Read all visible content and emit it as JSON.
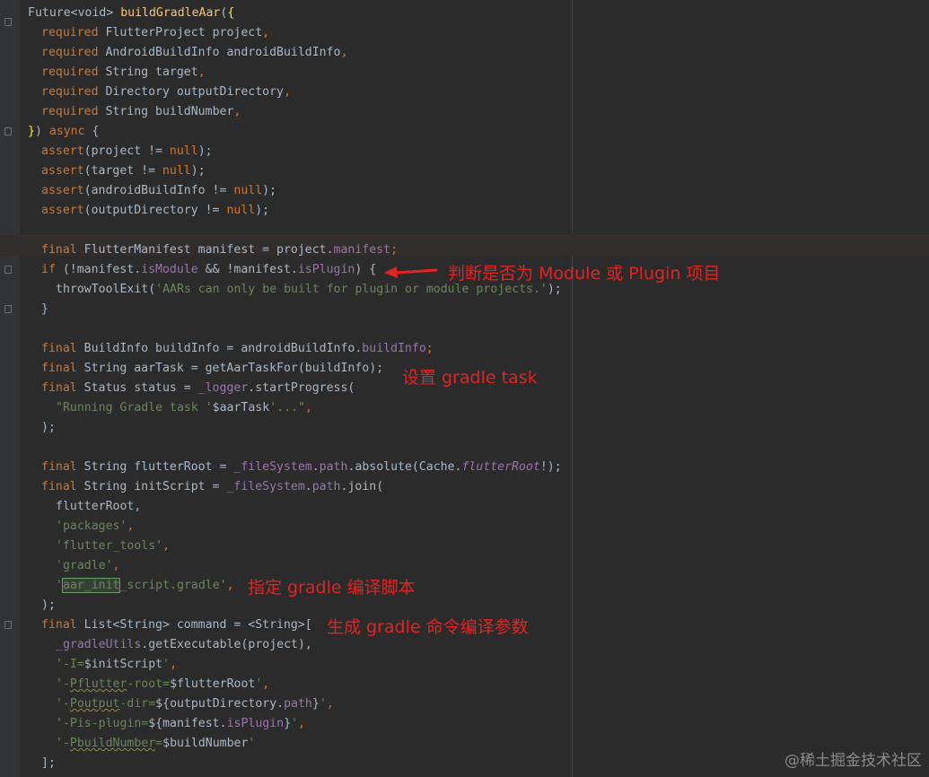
{
  "code": {
    "l1_a": "Future<void> ",
    "l1_fn": "buildGradleAar",
    "l1_p": "(",
    "l1_b": "{",
    "l2_kw": "required",
    "l2_t": " FlutterProject project",
    "l3_kw": "required",
    "l3_t": " AndroidBuildInfo androidBuildInfo",
    "l4_kw": "required",
    "l4_t": " String target",
    "l5_kw": "required",
    "l5_t": " Directory outputDirectory",
    "l6_kw": "required",
    "l6_t": " String buildNumber",
    "comma": ",",
    "l7_b": "}",
    "l7_p": ") ",
    "l7_kw": "async",
    "l7_o": " {",
    "assert": "assert",
    "null": "null",
    "l8_t": "(project != ",
    "l9_t": "(target != ",
    "l10_t": "(androidBuildInfo != ",
    "l11_t": "(outputDirectory != ",
    "close_semi": ");",
    "final": "final",
    "l13_t": " FlutterManifest manifest = project.",
    "l13_f": "manifest",
    "semi": ";",
    "l14_kw": "if",
    "l14_a": " (!manifest.",
    "l14_f1": "isModule",
    "l14_b": " && !manifest.",
    "l14_f2": "isPlugin",
    "l14_c": ") {",
    "l15_a": "throwToolExit(",
    "l15_s": "'AARs can only be built for plugin or module projects.'",
    "l16": "}",
    "l18_t": " BuildInfo buildInfo = androidBuildInfo.",
    "l18_f": "buildInfo",
    "l19_t": " String aarTask = getAarTaskFor(buildInfo);",
    "l20_t": " Status status = ",
    "l20_f": "_logger",
    "l20_u": ".startProgress(",
    "l21_s1": "\"Running Gradle task '",
    "l21_v": "$aarTask",
    "l21_s2": "'...\"",
    "l22": ");",
    "l24_t": " String flutterRoot = ",
    "l24_f": "_fileSystem",
    "l24_u": ".",
    "l24_p": "path",
    "l24_v": ".absolute(Cache.",
    "l24_i": "flutterRoot",
    "l24_e": "!);",
    "l25_t": " String initScript = ",
    "l25_f": "_fileSystem",
    "l25_u": ".",
    "l25_p": "path",
    "l25_v": ".join(",
    "l26": "flutterRoot,",
    "l27_s": "'packages'",
    "l28_s": "'flutter_tools'",
    "l29_s": "'gradle'",
    "l30_q": "'",
    "l30_box": "aar_init",
    "l30_s": "_script.gradle'",
    "l31": ");",
    "l32_t": " List<String> command = <String>[",
    "l33_f": "_gradleUtils",
    "l33_t": ".getExecutable(project),",
    "l34_s": "'-I=",
    "l34_v": "$initScript",
    "l34_e": "'",
    "l35_s1": "'-",
    "l35_sq": "Pflutter",
    "l35_s2": "-root=",
    "l35_v": "$flutterRoot",
    "l35_e": "'",
    "l36_s1": "'-",
    "l36_sq": "Poutput",
    "l36_s2": "-dir=",
    "l36_v1": "${",
    "l36_v2": "outputDirectory.",
    "l36_f": "path",
    "l36_v3": "}",
    "l36_e": "'",
    "l37_s1": "'-Pis-plugin=",
    "l37_v1": "${",
    "l37_v2": "manifest.",
    "l37_f": "isPlugin",
    "l37_v3": "}",
    "l37_e": "'",
    "l38_s1": "'-",
    "l38_sq": "PbuildNumber",
    "l38_s2": "=",
    "l38_v": "$buildNumber",
    "l38_e": "'",
    "l39": "];"
  },
  "annotations": {
    "note1": "判断是否为 Module 或 Plugin 项目",
    "note2": "设置 gradle task",
    "note3": "指定 gradle 编译脚本",
    "note4": "生成 gradle 命令编译参数",
    "color": "#e02424"
  },
  "watermark": "@稀土掘金技术社区"
}
